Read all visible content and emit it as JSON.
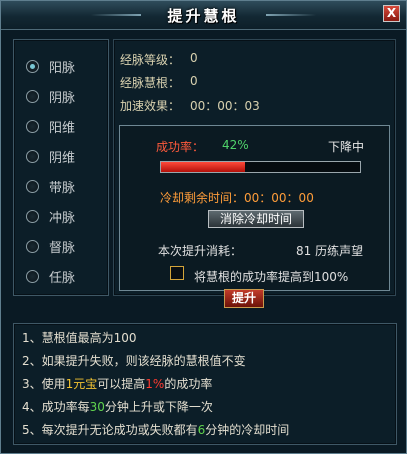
{
  "window": {
    "title": "提升慧根",
    "close_label": "X"
  },
  "meridians": {
    "selected_index": 0,
    "items": [
      {
        "label": "阳脉"
      },
      {
        "label": "阴脉"
      },
      {
        "label": "阳维"
      },
      {
        "label": "阴维"
      },
      {
        "label": "带脉"
      },
      {
        "label": "冲脉"
      },
      {
        "label": "督脉"
      },
      {
        "label": "任脉"
      }
    ]
  },
  "info": {
    "level_label": "经脉等级：",
    "level_value": "0",
    "wisdom_label": "经脉慧根：",
    "wisdom_value": "0",
    "speed_label": "加速效果：",
    "speed_value": "00：00：03"
  },
  "upgrade": {
    "rate_label": "成功率：",
    "rate_value": "42%",
    "rate_fraction": 0.42,
    "trend_label": "下降中",
    "cooldown_label": "冷却剩余时间：",
    "cooldown_value": "00：00：00",
    "clear_button": "消除冷却时间",
    "cost_label": "本次提升消耗：",
    "cost_value": "81 历练声望",
    "checkbox_label": "将慧根的成功率提高到100%",
    "checkbox_checked": false,
    "upgrade_button": "提升"
  },
  "tips": {
    "t1": "1、慧根值最高为100",
    "t2": "2、如果提升失败，则该经脉的慧根值不变",
    "t3_a": "3、使用",
    "t3_b": "1元宝",
    "t3_c": "可以提高",
    "t3_d": "1%",
    "t3_e": "的成功率",
    "t4_a": "4、成功率每",
    "t4_b": "30",
    "t4_c": "分钟上升或下降一次",
    "t5_a": "5、每次提升无论成功或失败都有",
    "t5_b": "6",
    "t5_c": "分钟的冷却时间"
  },
  "colors": {
    "rate_label": "#ff5a3c",
    "rate_value": "#4fd36a",
    "cooldown": "#ff9d3a",
    "highlight_yellow": "#f2c331",
    "highlight_red": "#ff3b30",
    "highlight_green": "#61d34e"
  }
}
